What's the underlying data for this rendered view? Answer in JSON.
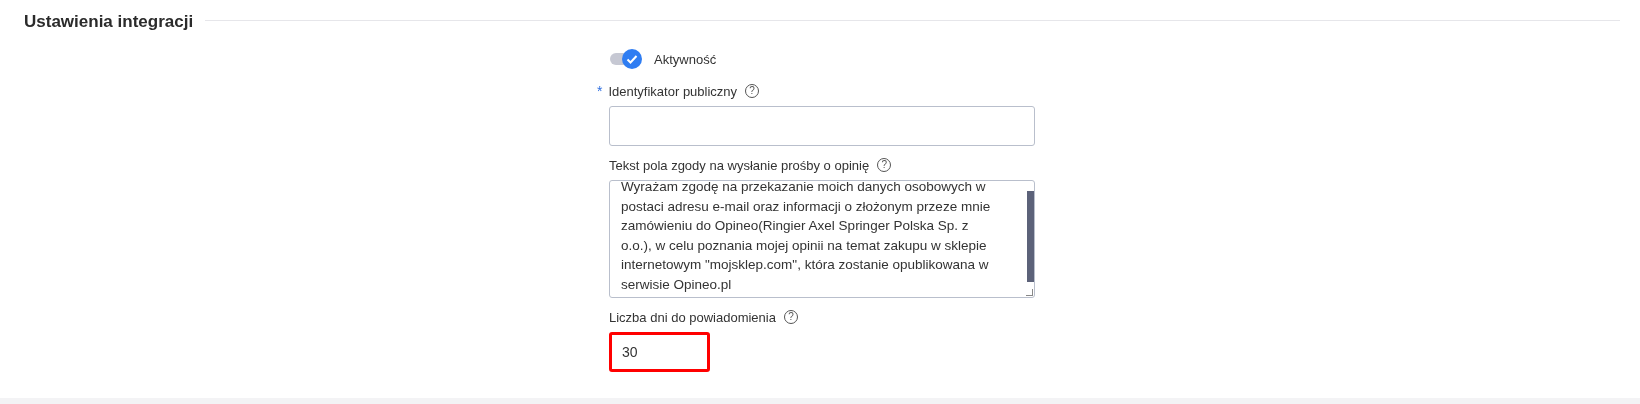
{
  "section": {
    "title": "Ustawienia integracji"
  },
  "fields": [
    {
      "kind": "toggle",
      "label": "Aktywność",
      "on": true
    },
    {
      "kind": "input",
      "label": "Identyfikator publiczny",
      "required": true,
      "required_mark": "*",
      "help": "?",
      "highlighted": false
    },
    {
      "kind": "textarea",
      "label": "Tekst pola zgody na wysłanie prośby o opinię",
      "help": "?",
      "value": "Wyrażam zgodę na przekazanie moich danych osobowych w postaci adresu e-mail oraz informacji o złożonym przeze mnie zamówieniu do Opineo(Ringier Axel Springer Polska Sp. z o.o.), w celu poznania mojej opinii na temat zakupu w sklepie internetowym \"mojsklep.com\", która zostanie opublikowana w serwisie Opineo.pl"
    },
    {
      "kind": "input",
      "label": "Liczba dni do powiadomienia",
      "help": "?",
      "value": "30",
      "highlighted": true,
      "short": true
    }
  ]
}
